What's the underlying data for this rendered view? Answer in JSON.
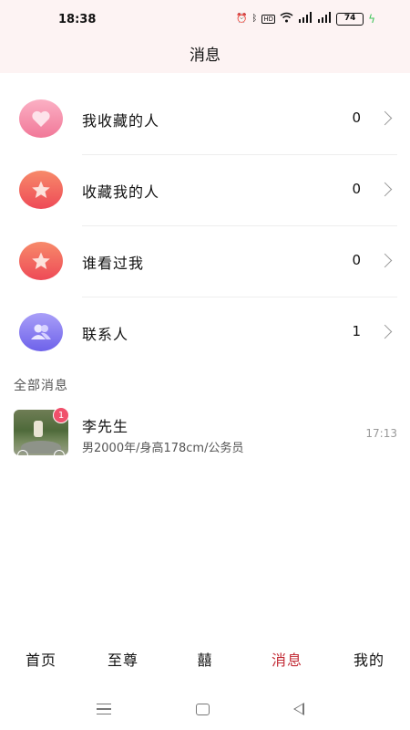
{
  "status_bar": {
    "time": "18:38",
    "battery": "74"
  },
  "header": {
    "title": "消息"
  },
  "menu": [
    {
      "label": "我收藏的人",
      "count": "0",
      "icon": "heart-icon",
      "color": "#f58fab"
    },
    {
      "label": "收藏我的人",
      "count": "0",
      "icon": "star-icon",
      "color": "#f0575b"
    },
    {
      "label": "谁看过我",
      "count": "0",
      "icon": "star-icon",
      "color": "#f0575b"
    },
    {
      "label": "联系人",
      "count": "1",
      "icon": "people-icon",
      "color": "#7b6ff0"
    }
  ],
  "section": {
    "title": "全部消息"
  },
  "messages": [
    {
      "name": "李先生",
      "desc": "男2000年/身高178cm/公务员",
      "time": "17:13",
      "unread": "1"
    }
  ],
  "tabs": [
    {
      "label": "首页",
      "active": false
    },
    {
      "label": "至尊",
      "active": false
    },
    {
      "label": "囍",
      "active": false
    },
    {
      "label": "消息",
      "active": true
    },
    {
      "label": "我的",
      "active": false
    }
  ],
  "colors": {
    "accent": "#c22b35",
    "badge": "#f0506b",
    "header_bg": "#fdf3f3"
  }
}
